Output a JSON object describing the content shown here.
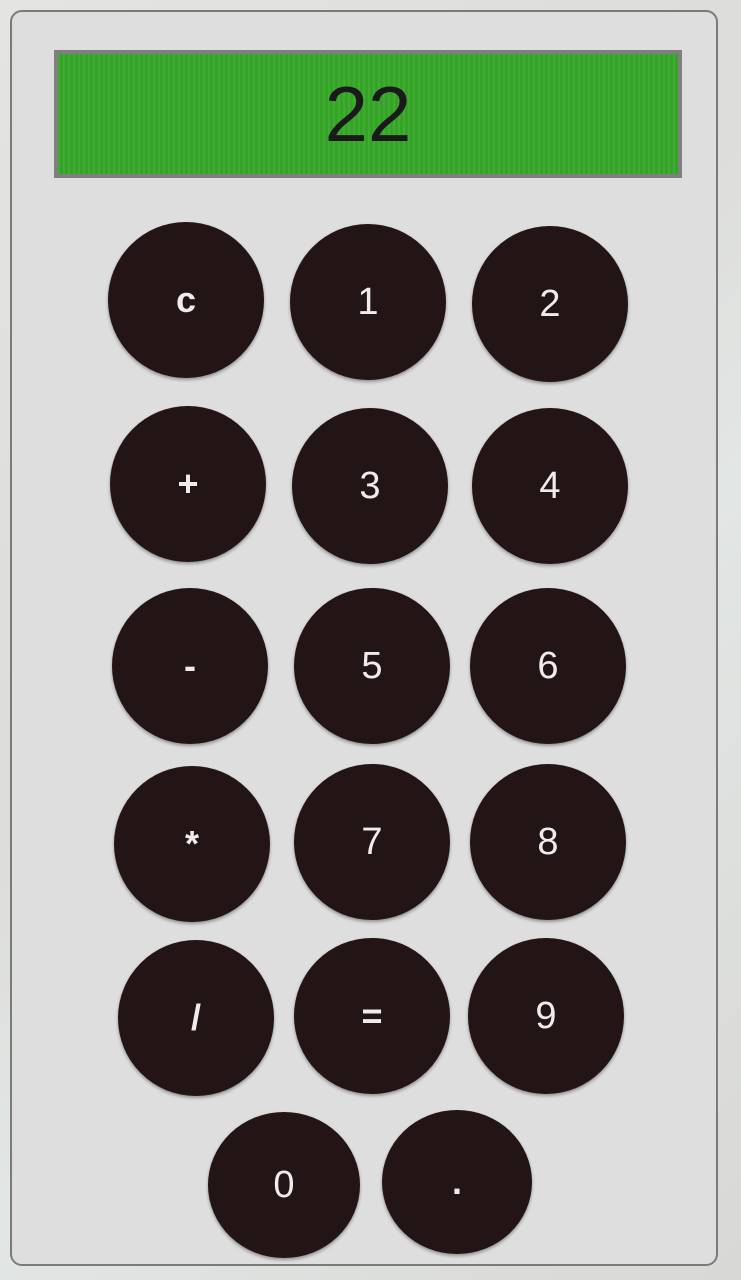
{
  "display": {
    "value": "22"
  },
  "keypad": {
    "rows": [
      [
        "c",
        "1",
        "2"
      ],
      [
        "+",
        "3",
        "4"
      ],
      [
        "-",
        "5",
        "6"
      ],
      [
        "*",
        "7",
        "8"
      ],
      [
        "/",
        "=",
        "9"
      ],
      [
        "0",
        "."
      ]
    ]
  },
  "colors": {
    "display_background": "#36a829",
    "key_background": "#231416",
    "key_text": "#f0ecec",
    "panel_background": "#dedede"
  }
}
